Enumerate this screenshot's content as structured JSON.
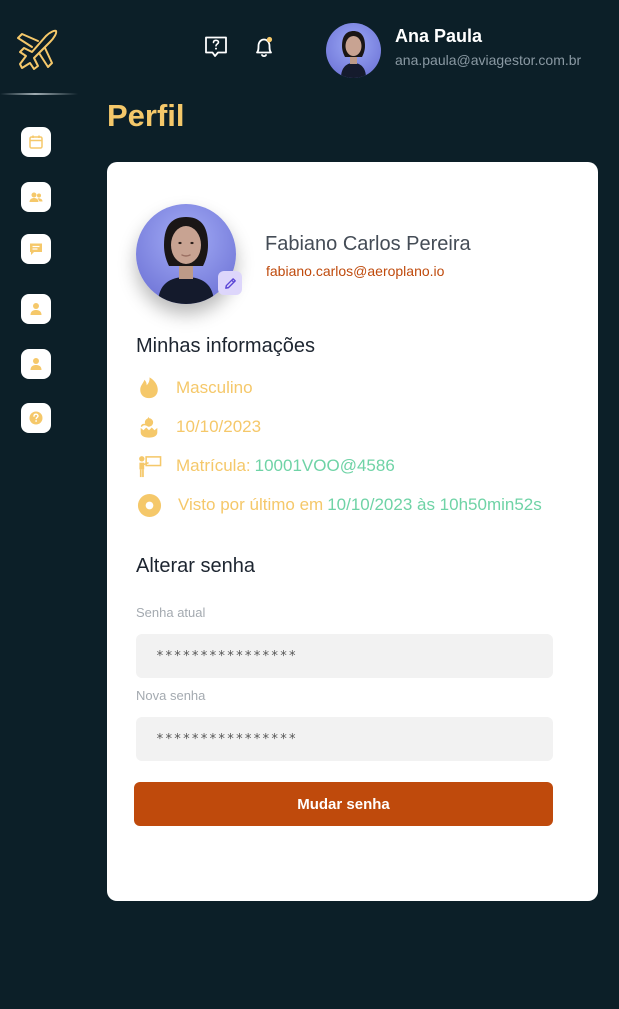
{
  "header": {
    "user_name": "Ana Paula",
    "user_email": "ana.paula@aviagestor.com.br"
  },
  "sidebar": {
    "items": [
      {
        "name": "calendar"
      },
      {
        "name": "users"
      },
      {
        "name": "chat"
      },
      {
        "name": "user"
      },
      {
        "name": "user"
      },
      {
        "name": "help"
      }
    ]
  },
  "page": {
    "title": "Perfil"
  },
  "profile": {
    "name": "Fabiano Carlos Pereira",
    "email": "fabiano.carlos@aeroplano.io"
  },
  "info": {
    "title": "Minhas informações",
    "gender": "Masculino",
    "birth_date": "10/10/2023",
    "registration_label": "Matrícula:",
    "registration_value": "10001VOO@4586",
    "last_seen_label": "Visto por último em",
    "last_seen_value": "10/10/2023 às 10h50min52s"
  },
  "password": {
    "title": "Alterar senha",
    "current_label": "Senha atual",
    "current_value": "****************",
    "new_label": "Nova senha",
    "new_value": "****************",
    "submit_label": "Mudar senha"
  },
  "colors": {
    "background": "#0c1f28",
    "accent": "#f5c86a",
    "primary_button": "#bf4a0c",
    "value_green": "#6fd3a6",
    "edit_badge": "#ddd6fb"
  }
}
